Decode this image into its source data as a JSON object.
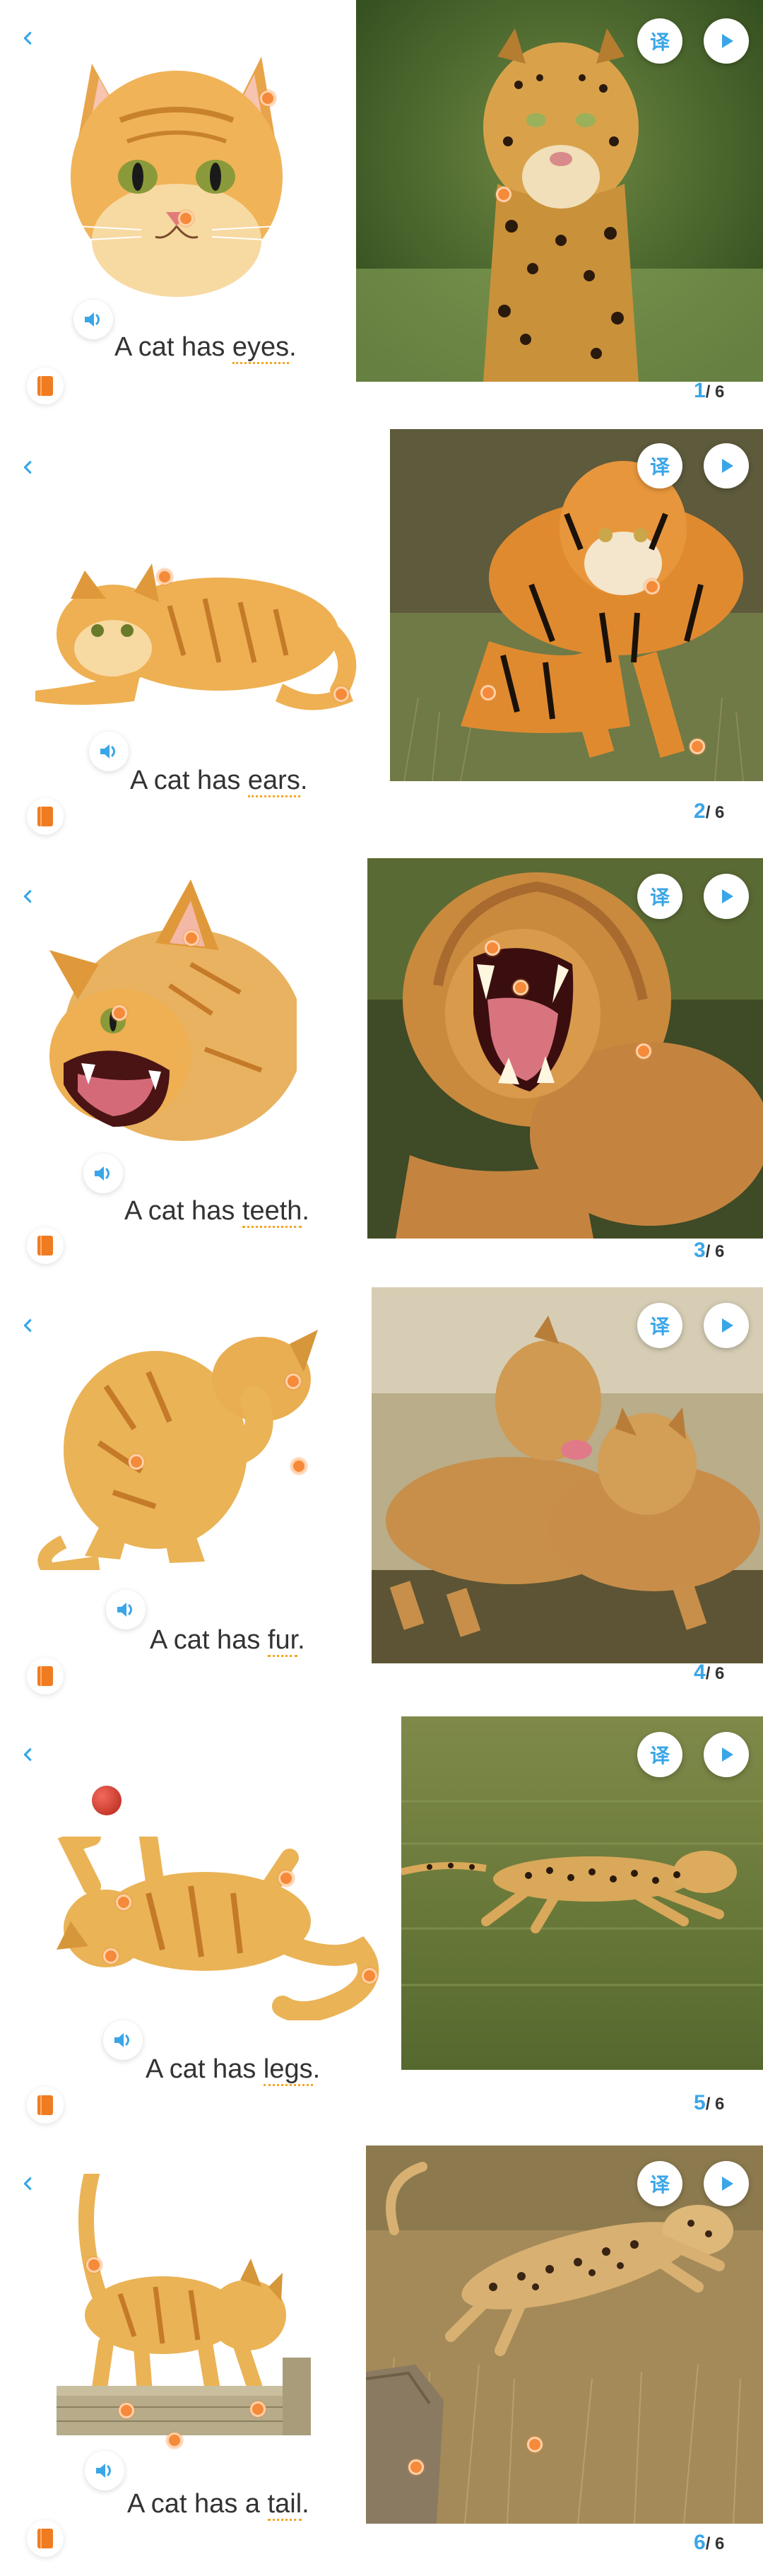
{
  "pages": [
    {
      "sentence_prefix": "A cat has ",
      "keyword": "eyes",
      "suffix": ".",
      "current": "1",
      "total": "/ 6",
      "translate_label": "译",
      "animal": "leopard"
    },
    {
      "sentence_prefix": "A cat has ",
      "keyword": "ears",
      "suffix": ".",
      "current": "2",
      "total": "/ 6",
      "translate_label": "译",
      "animal": "tiger"
    },
    {
      "sentence_prefix": "A cat has ",
      "keyword": "teeth",
      "suffix": ".",
      "current": "3",
      "total": "/ 6",
      "translate_label": "译",
      "animal": "lion"
    },
    {
      "sentence_prefix": "A cat has ",
      "keyword": "fur",
      "suffix": ".",
      "current": "4",
      "total": "/ 6",
      "translate_label": "译",
      "animal": "lioness-and-cub"
    },
    {
      "sentence_prefix": "A cat has ",
      "keyword": "legs",
      "suffix": ".",
      "current": "5",
      "total": "/ 6",
      "translate_label": "译",
      "animal": "cheetah"
    },
    {
      "sentence_prefix": "A cat has a ",
      "keyword": "tail",
      "suffix": ".",
      "current": "6",
      "total": "/ 6",
      "translate_label": "译",
      "animal": "leopard-jumping"
    }
  ],
  "icons": {
    "back": "chevron-left-icon",
    "speaker": "speaker-icon",
    "book": "book-icon",
    "play": "play-icon"
  },
  "colors": {
    "accent_blue": "#3aa6e8",
    "hotspot_orange": "#f58a3a",
    "keyword_underline": "#f5a623",
    "book_orange": "#f07c22"
  }
}
